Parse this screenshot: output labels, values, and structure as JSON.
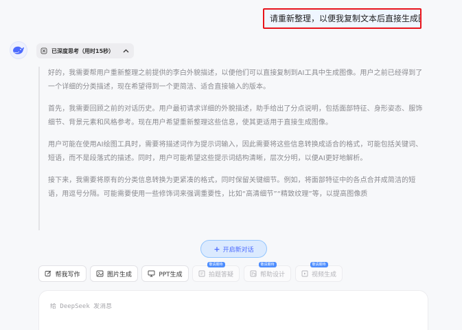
{
  "user_message": "请重新整理，以便我复制文本后直接生成图像",
  "thinking": {
    "label": "已深度思考（用时15秒）",
    "toggle_icon": "chevron-up-icon",
    "paragraphs": [
      "好的，我需要帮用户重新整理之前提供的李白外貌描述，以便他们可以直接复制到AI工具中生成图像。用户之前已经得到了一个详细的分类描述，现在希望得到一个更简洁、适合直接输入的版本。",
      "首先，我需要回顾之前的对话历史。用户最初请求详细的外貌描述，助手给出了分点说明，包括面部特征、身形姿态、服饰细节、背景元素和风格参考。现在用户希望重新整理这些信息，使其更适用于直接生成图像。",
      "用户可能在使用AI绘图工具时，需要将描述词作为提示词输入，因此需要将这些信息转换成适合的格式，可能包括关键词、短语，而不是段落式的描述。同时，用户可能希望这些提示词结构清晰，层次分明，以便AI更好地解析。",
      "接下来，我需要将原有的分类信息转换为更紧凑的格式，同时保留关键细节。例如，将面部特征中的各点合并成简洁的短语，用逗号分隔。可能需要使用一些修饰词来强调重要性，比如“高清细节”“精致纹理”等，以提高图像质"
    ]
  },
  "new_chat_label": "开启新对话",
  "tools": [
    {
      "label": "帮我写作",
      "icon": "pen-icon",
      "enabled": true
    },
    {
      "label": "图片生成",
      "icon": "image-icon",
      "enabled": true
    },
    {
      "label": "PPT生成",
      "icon": "presentation-icon",
      "enabled": true
    },
    {
      "label": "拍题答疑",
      "icon": "camera-icon",
      "enabled": false,
      "badge": "敬请期待"
    },
    {
      "label": "帮助设计",
      "icon": "design-icon",
      "enabled": false,
      "badge": "敬请期待"
    },
    {
      "label": "视频生成",
      "icon": "video-icon",
      "enabled": false,
      "badge": "敬请期待"
    }
  ],
  "composer": {
    "placeholder": "给 DeepSeek 发消息"
  },
  "colors": {
    "brand": "#4d6bfe",
    "highlight_border": "#e8121a"
  }
}
